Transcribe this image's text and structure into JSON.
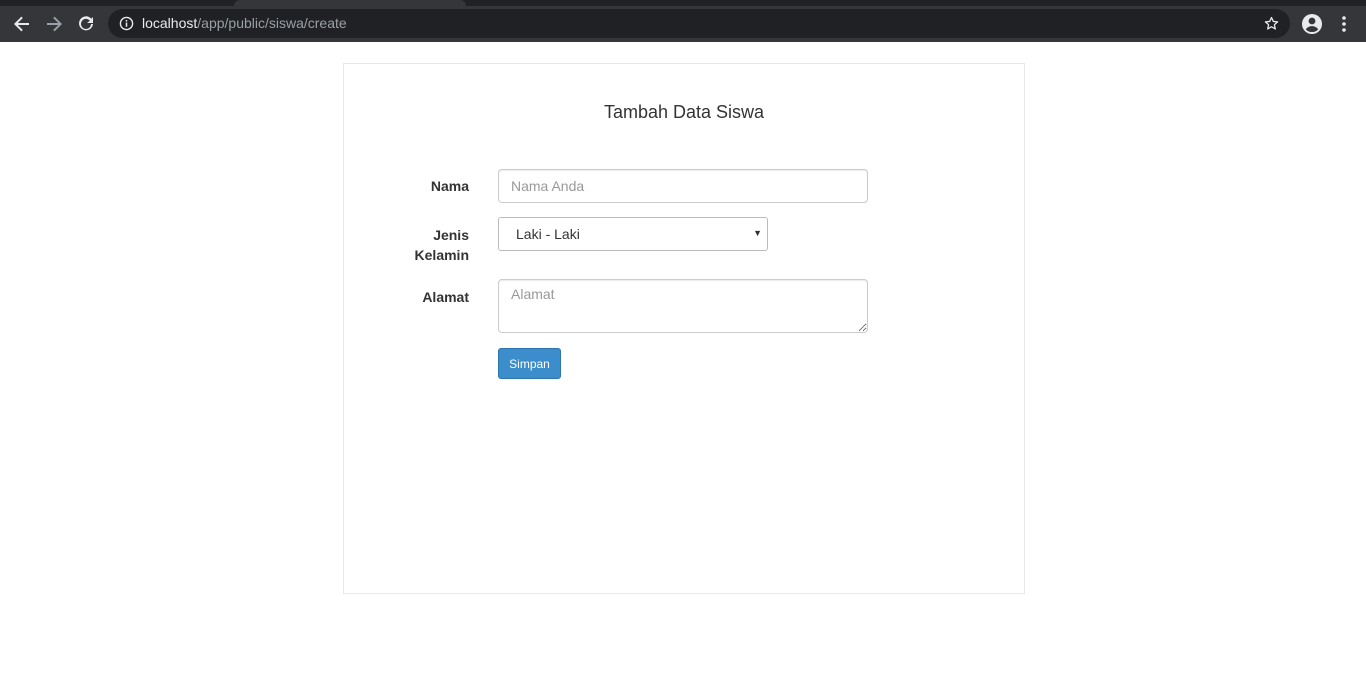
{
  "browser": {
    "url_host": "localhost",
    "url_path": "/app/public/siswa/create",
    "icons": {
      "back": "arrow-left-icon",
      "forward": "arrow-right-icon",
      "reload": "reload-icon",
      "info": "info-icon",
      "star": "star-icon",
      "profile": "account-circle-icon",
      "menu": "kebab-menu-icon"
    }
  },
  "form": {
    "title": "Tambah Data Siswa",
    "nama": {
      "label": "Nama",
      "placeholder": "Nama Anda",
      "value": ""
    },
    "jenis_kelamin": {
      "label_line1": "Jenis",
      "label_line2": "Kelamin",
      "selected": "Laki - Laki"
    },
    "alamat": {
      "label": "Alamat",
      "placeholder": "Alamat",
      "value": ""
    },
    "submit_label": "Simpan"
  },
  "colors": {
    "primary_button": "#3c8dcc",
    "chrome_toolbar": "#35363a",
    "chrome_omnibox": "#202124"
  }
}
